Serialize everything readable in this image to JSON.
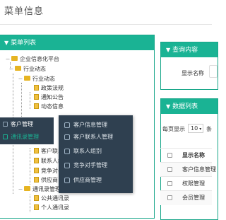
{
  "page": {
    "title": "菜单信息"
  },
  "menu_panel": {
    "title": "菜单列表",
    "tree": [
      {
        "label": "企业信息化平台"
      },
      {
        "label": "行业动态"
      },
      {
        "label": "行业动态"
      },
      {
        "label": "政策法规"
      },
      {
        "label": "通知公告"
      },
      {
        "label": "动态信息"
      },
      {
        "label": "客户联系"
      },
      {
        "label": "联系人组"
      },
      {
        "label": "竞争对手"
      },
      {
        "label": "供应商"
      },
      {
        "label": "通讯录管理"
      },
      {
        "label": "公共通讯录"
      },
      {
        "label": "个人通讯录"
      }
    ]
  },
  "context_menu": {
    "left_items": [
      {
        "label": "客户管理"
      },
      {
        "label": "通讯录管理"
      }
    ],
    "right_items": [
      {
        "label": "客户信息管理"
      },
      {
        "label": "客户联系人管理"
      },
      {
        "label": "联系人组别"
      },
      {
        "label": "竞争对手管理"
      },
      {
        "label": "供应商管理"
      }
    ]
  },
  "query_panel": {
    "title": "查询内容",
    "field_label": "显示名称"
  },
  "data_panel": {
    "title": "数据列表",
    "pager_prefix": "每页显示",
    "page_size": "10",
    "page_size_suffix": "条",
    "column_header": "显示名称",
    "rows": [
      {
        "name": "客户信息管理"
      },
      {
        "name": "权限管理"
      },
      {
        "name": "会员管理"
      }
    ]
  },
  "colors": {
    "accent": "#1ab394",
    "menu_bg": "#2f4050"
  }
}
